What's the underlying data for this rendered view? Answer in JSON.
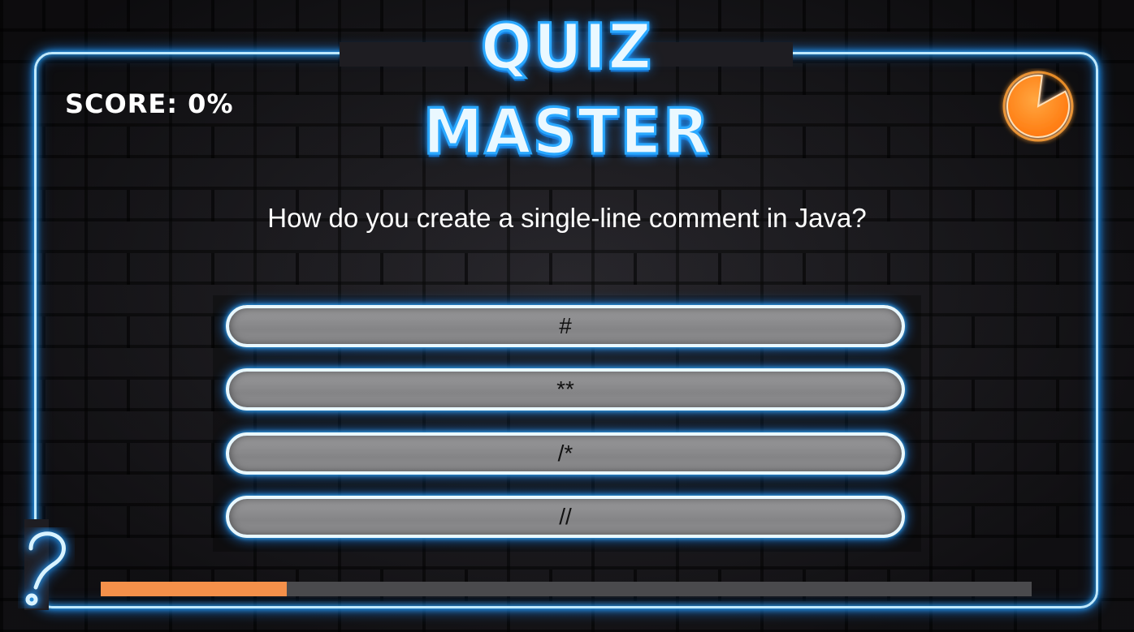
{
  "game": {
    "title": "QUIZ MASTER",
    "score_label": "SCORE: 0%",
    "timer": {
      "remaining_fraction": 0.85,
      "color": "#ff8a1a"
    },
    "question": "How do you create a single-line comment in Java?",
    "answers": [
      "#",
      "**",
      "/*",
      "//"
    ],
    "progress": {
      "fraction": 0.2,
      "fill_color": "#f4904a",
      "track_color": "#4a4a4d"
    },
    "help_icon": "question-mark-icon",
    "accent_color": "#2aa8ff"
  }
}
